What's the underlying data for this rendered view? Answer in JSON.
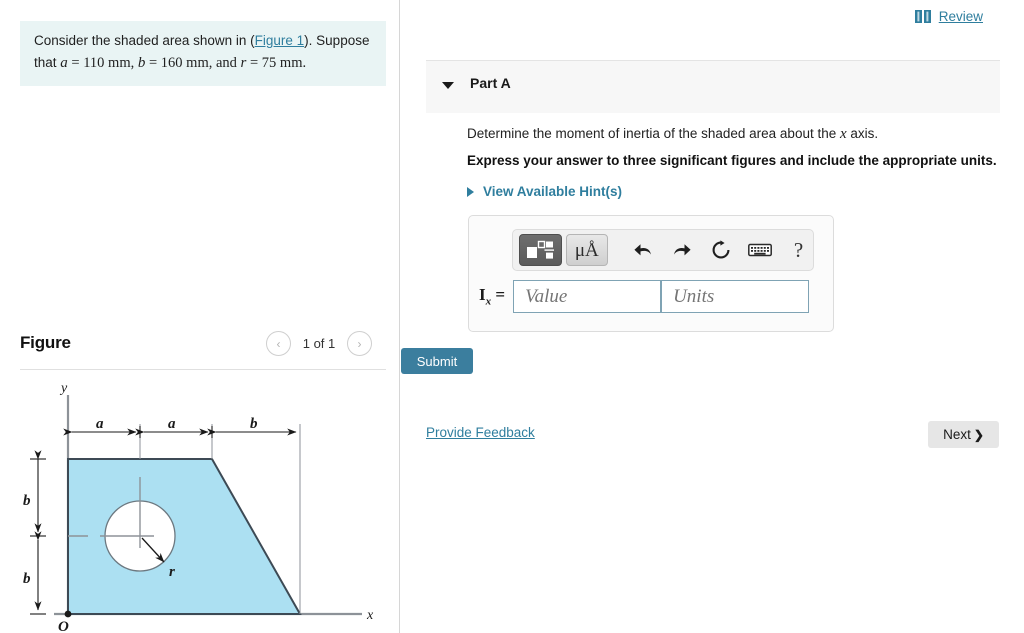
{
  "problem": {
    "text_before_link": "Consider the shaded area shown in (",
    "figure_link": "Figure 1",
    "text_after_link": "). Suppose that ",
    "var_a": "a",
    "eq_a": " = 110 mm, ",
    "var_b": "b",
    "eq_b": " = 160 mm, and ",
    "var_r": "r",
    "eq_r": " = 75 mm."
  },
  "figure_panel": {
    "title": "Figure",
    "pager_count": "1 of 1",
    "prev_icon": "chevron-left-icon",
    "next_icon": "chevron-right-icon",
    "prev_glyph": "‹",
    "next_glyph": "›"
  },
  "figure": {
    "axis_y_label": "y",
    "axis_x_label": "x",
    "origin_label": "O",
    "dim_a1": "a",
    "dim_a2": "a",
    "dim_b_top": "b",
    "dim_b_left_upper": "b",
    "dim_b_left_lower": "b",
    "radius_label": "r",
    "shape_fill": "#ace0f2",
    "shape_stroke": "#3d4a55",
    "axis_color": "#8d9298",
    "dim_color": "#1a1a1a"
  },
  "header": {
    "review_label": "Review",
    "review_icon": "book-icon",
    "review_color": "#2f7e9e"
  },
  "part": {
    "title": "Part A",
    "caret_icon": "caret-down-icon",
    "question": "Determine the moment of inertia of the shaded area about the ",
    "question_var": "x",
    "question_tail": " axis.",
    "instruction": "Express your answer to three significant figures and include the appropriate units.",
    "hints_label": "View Available Hint(s)",
    "hints_caret_icon": "caret-right-icon"
  },
  "answer": {
    "toolbar": {
      "template_button_icon": "math-template-icon",
      "units_button_label": "μÅ",
      "units_button_icon": "units-icon",
      "undo_icon": "undo-arrow-icon",
      "redo_icon": "redo-arrow-icon",
      "reset_icon": "reset-circle-icon",
      "keyboard_icon": "keyboard-icon",
      "help_label": "?",
      "help_icon": "help-icon"
    },
    "label_symbol": "I",
    "label_subscript": "x",
    "label_equals": " =",
    "value_placeholder": "Value",
    "units_placeholder": "Units"
  },
  "actions": {
    "submit_label": "Submit",
    "submit_color": "#3b7e9e",
    "provide_feedback_label": "Provide Feedback",
    "next_label": "Next",
    "next_chevron": "❯",
    "next_icon": "chevron-right-icon"
  }
}
